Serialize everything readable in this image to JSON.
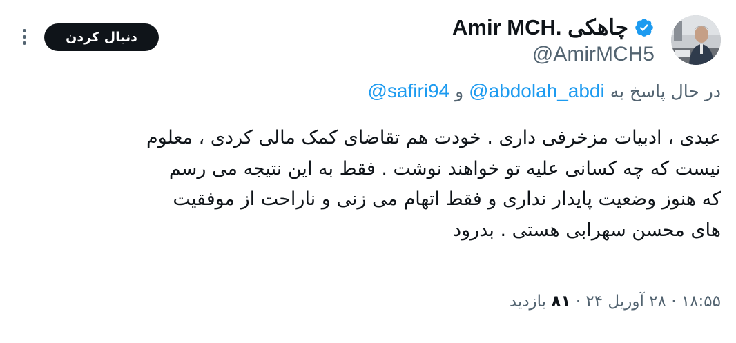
{
  "author": {
    "display_name": "Amir MCH. چاهکی",
    "handle": "@AmirMCH5",
    "avatar_icon": "profile-photo",
    "verified_icon": "verified-badge-icon",
    "verified_color": "#1d9bf0"
  },
  "follow_button": {
    "label": "دنبال کردن"
  },
  "more_icon": "more-horizontal-icon",
  "replying": {
    "prefix": "در حال پاسخ به",
    "mention1": "@abdolah_abdi",
    "joiner": "و",
    "mention2": "@safiri94"
  },
  "tweet": {
    "lines": [
      "عبدی ، ادبیات  مزخرفی داری . خودت هم تقاضای کمک مالی کردی ، معلوم",
      "نیست که چه کسانی علیه تو خواهند نوشت . فقط به این نتیجه می رسم",
      "که هنوز وضعیت پایدار نداری و فقط  اتهام می زنی  و ناراحت از موفقیت",
      "های محسن سهرابی هستی . بدرود"
    ]
  },
  "meta": {
    "time": "۱۸:۵۵",
    "separator": "·",
    "date": "۲۸ آوریل ۲۴",
    "views_count": "۸۱",
    "views_label": "بازدید"
  },
  "colors": {
    "text": "#0f1419",
    "secondary": "#536471",
    "link": "#1d9bf0",
    "button_bg": "#0f1419"
  }
}
